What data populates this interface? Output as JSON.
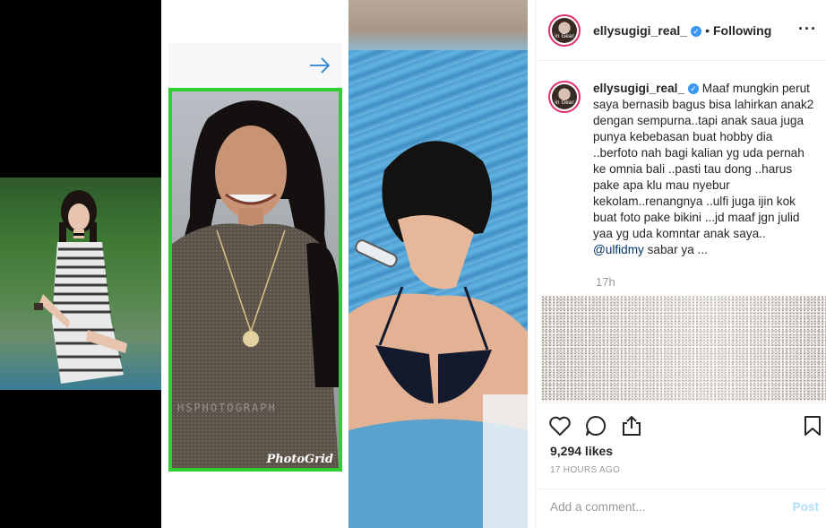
{
  "media": {
    "watermark_text": "HSPHOTOGRAPH",
    "photogrid_label": "PhotoGrid",
    "arrow_icon": "arrow-right-icon"
  },
  "header": {
    "username": "ellysugigi_real_",
    "separator": "•",
    "follow_status": "Following",
    "more_label": "···"
  },
  "caption": {
    "username": "ellysugigi_real_",
    "text": "Maaf mungkin perut saya bernasib bagus bisa lahirkan anak2 dengan sempurna..tapi anak saua juga punya kebebasan buat hobby dia ..berfoto nah bagi kalian yg uda pernah ke omnia bali ..pasti tau dong ..harus pake apa klu mau nyebur kekolam..renangnya ..ulfi juga ijin kok buat foto pake bikini ...jd maaf jgn julid yaa yg uda komntar anak saya..",
    "mention": "@ulfidmy",
    "tail": " sabar ya ...",
    "time": "17h"
  },
  "actions": {
    "icons": [
      "heart-icon",
      "comment-icon",
      "share-icon",
      "bookmark-icon"
    ]
  },
  "stats": {
    "likes": "9,294 likes",
    "posted_ago": "17 HOURS AGO"
  },
  "comment": {
    "placeholder": "Add a comment...",
    "post_label": "Post"
  },
  "colors": {
    "verified": "#3897f0",
    "post_disabled": "#b2dffc",
    "border": "#efefef",
    "photogrid_frame": "#2fcf33"
  }
}
